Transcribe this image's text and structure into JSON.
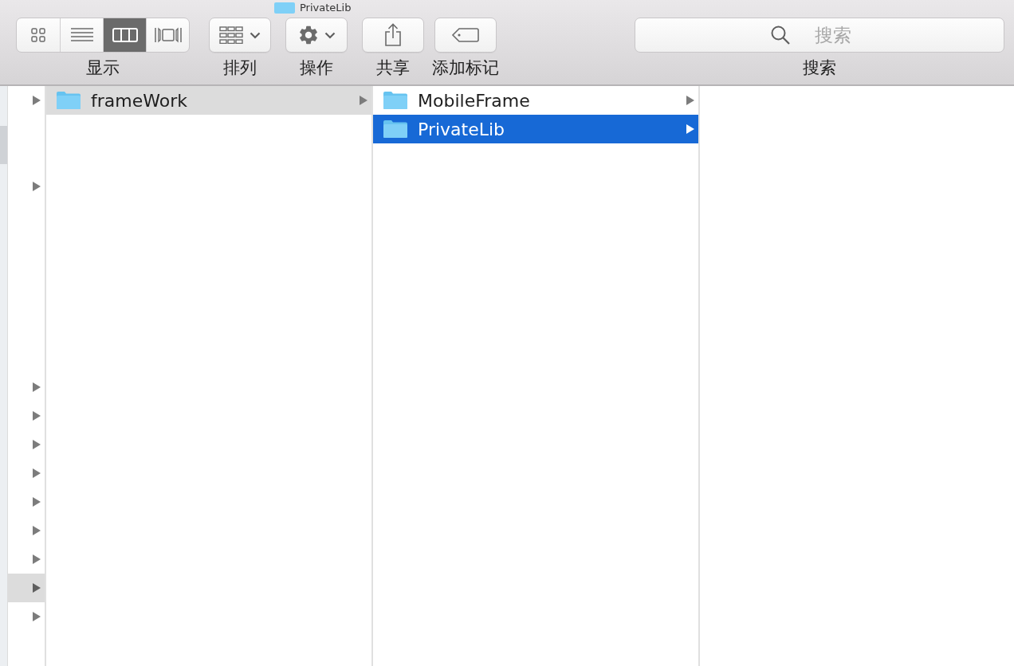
{
  "window": {
    "title": "PrivateLib"
  },
  "toolbar": {
    "view_modes": [
      {
        "kind": "icons",
        "selected": false
      },
      {
        "kind": "list",
        "selected": false
      },
      {
        "kind": "columns",
        "selected": true
      },
      {
        "kind": "gallery",
        "selected": false
      }
    ],
    "view_label": "显示",
    "sort_label": "排列",
    "action_label": "操作",
    "share_label": "共享",
    "tag_label": "添加标记",
    "search": {
      "placeholder": "搜索",
      "label": "搜索"
    }
  },
  "columns": [
    {
      "rows": [
        {
          "expandable": true,
          "selected": false
        },
        {
          "expandable": false,
          "selected": false
        },
        {
          "expandable": false,
          "selected": false
        },
        {
          "expandable": true,
          "selected": false
        },
        {
          "expandable": false,
          "selected": false
        },
        {
          "expandable": false,
          "selected": false
        },
        {
          "expandable": false,
          "selected": false
        },
        {
          "expandable": false,
          "selected": false
        },
        {
          "expandable": false,
          "selected": false
        },
        {
          "expandable": false,
          "selected": false
        },
        {
          "expandable": true,
          "selected": false
        },
        {
          "expandable": true,
          "selected": false
        },
        {
          "expandable": true,
          "selected": false
        },
        {
          "expandable": true,
          "selected": false
        },
        {
          "expandable": true,
          "selected": false
        },
        {
          "expandable": true,
          "selected": false
        },
        {
          "expandable": true,
          "selected": false
        },
        {
          "expandable": true,
          "selected": true
        },
        {
          "expandable": true,
          "selected": false
        }
      ]
    },
    {
      "items": [
        {
          "name": "frameWork",
          "selected": true,
          "focused": false
        }
      ]
    },
    {
      "items": [
        {
          "name": "MobileFrame",
          "selected": false
        },
        {
          "name": "PrivateLib",
          "selected": true,
          "focused": true
        }
      ]
    }
  ]
}
